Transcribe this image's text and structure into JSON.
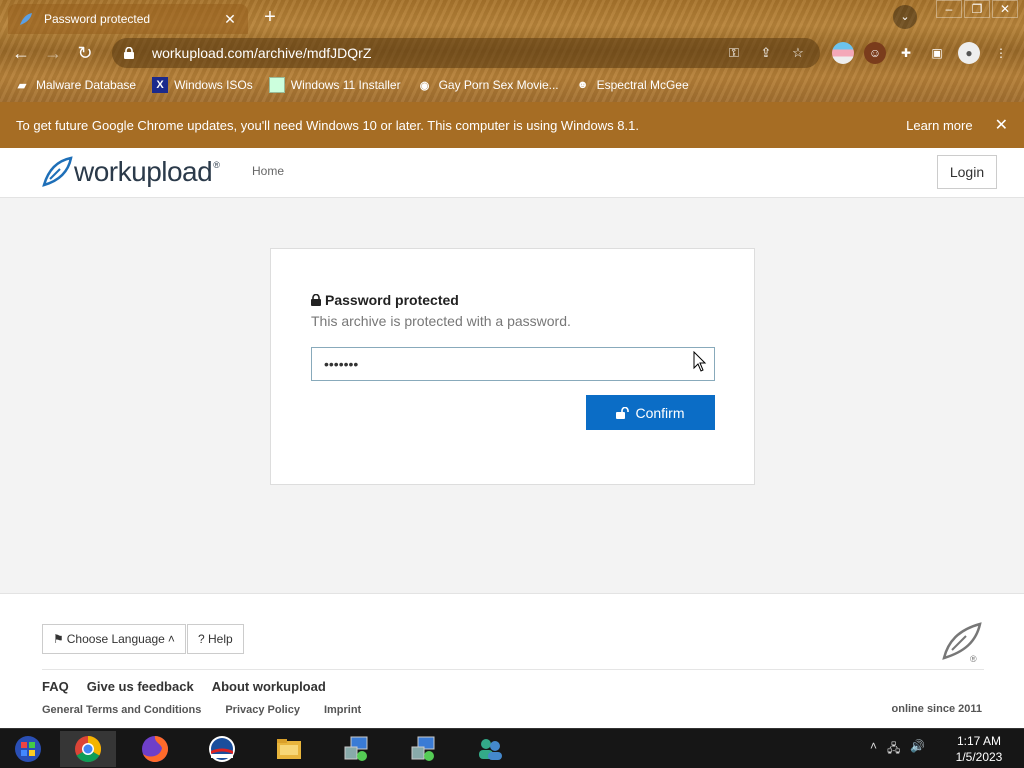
{
  "browser": {
    "tab_title": "Password protected",
    "url": "workupload.com/archive/mdfJDQrZ",
    "bookmarks": [
      {
        "label": "Malware Database",
        "icon": "folder-icon"
      },
      {
        "label": "Windows ISOs",
        "icon": "x-logo-icon"
      },
      {
        "label": "Windows 11 Installer",
        "icon": "image-icon"
      },
      {
        "label": "Gay Porn Sex Movie...",
        "icon": "globe-icon"
      },
      {
        "label": "Espectral McGee",
        "icon": "avatar-icon"
      }
    ],
    "infobar": {
      "message": "To get future Google Chrome updates, you'll need Windows 10 or later. This computer is using Windows 8.1.",
      "learn_more": "Learn more"
    }
  },
  "site": {
    "logo_text": "workupload",
    "logo_reg": "®",
    "nav_home": "Home",
    "login": "Login"
  },
  "form": {
    "heading": "Password protected",
    "description": "This archive is protected with a password.",
    "password_value": "•••••••",
    "confirm_label": "Confirm"
  },
  "footer": {
    "language_button": "Choose Language",
    "help_button": "? Help",
    "links": [
      "FAQ",
      "Give us feedback",
      "About workupload"
    ],
    "legal": [
      "General Terms and Conditions",
      "Privacy Policy",
      "Imprint"
    ],
    "since": "online since 2011",
    "reg": "®"
  },
  "taskbar": {
    "time": "1:17 AM",
    "date": "1/5/2023"
  },
  "colors": {
    "accent": "#0b6dc6",
    "infobar": "#a66d24"
  }
}
